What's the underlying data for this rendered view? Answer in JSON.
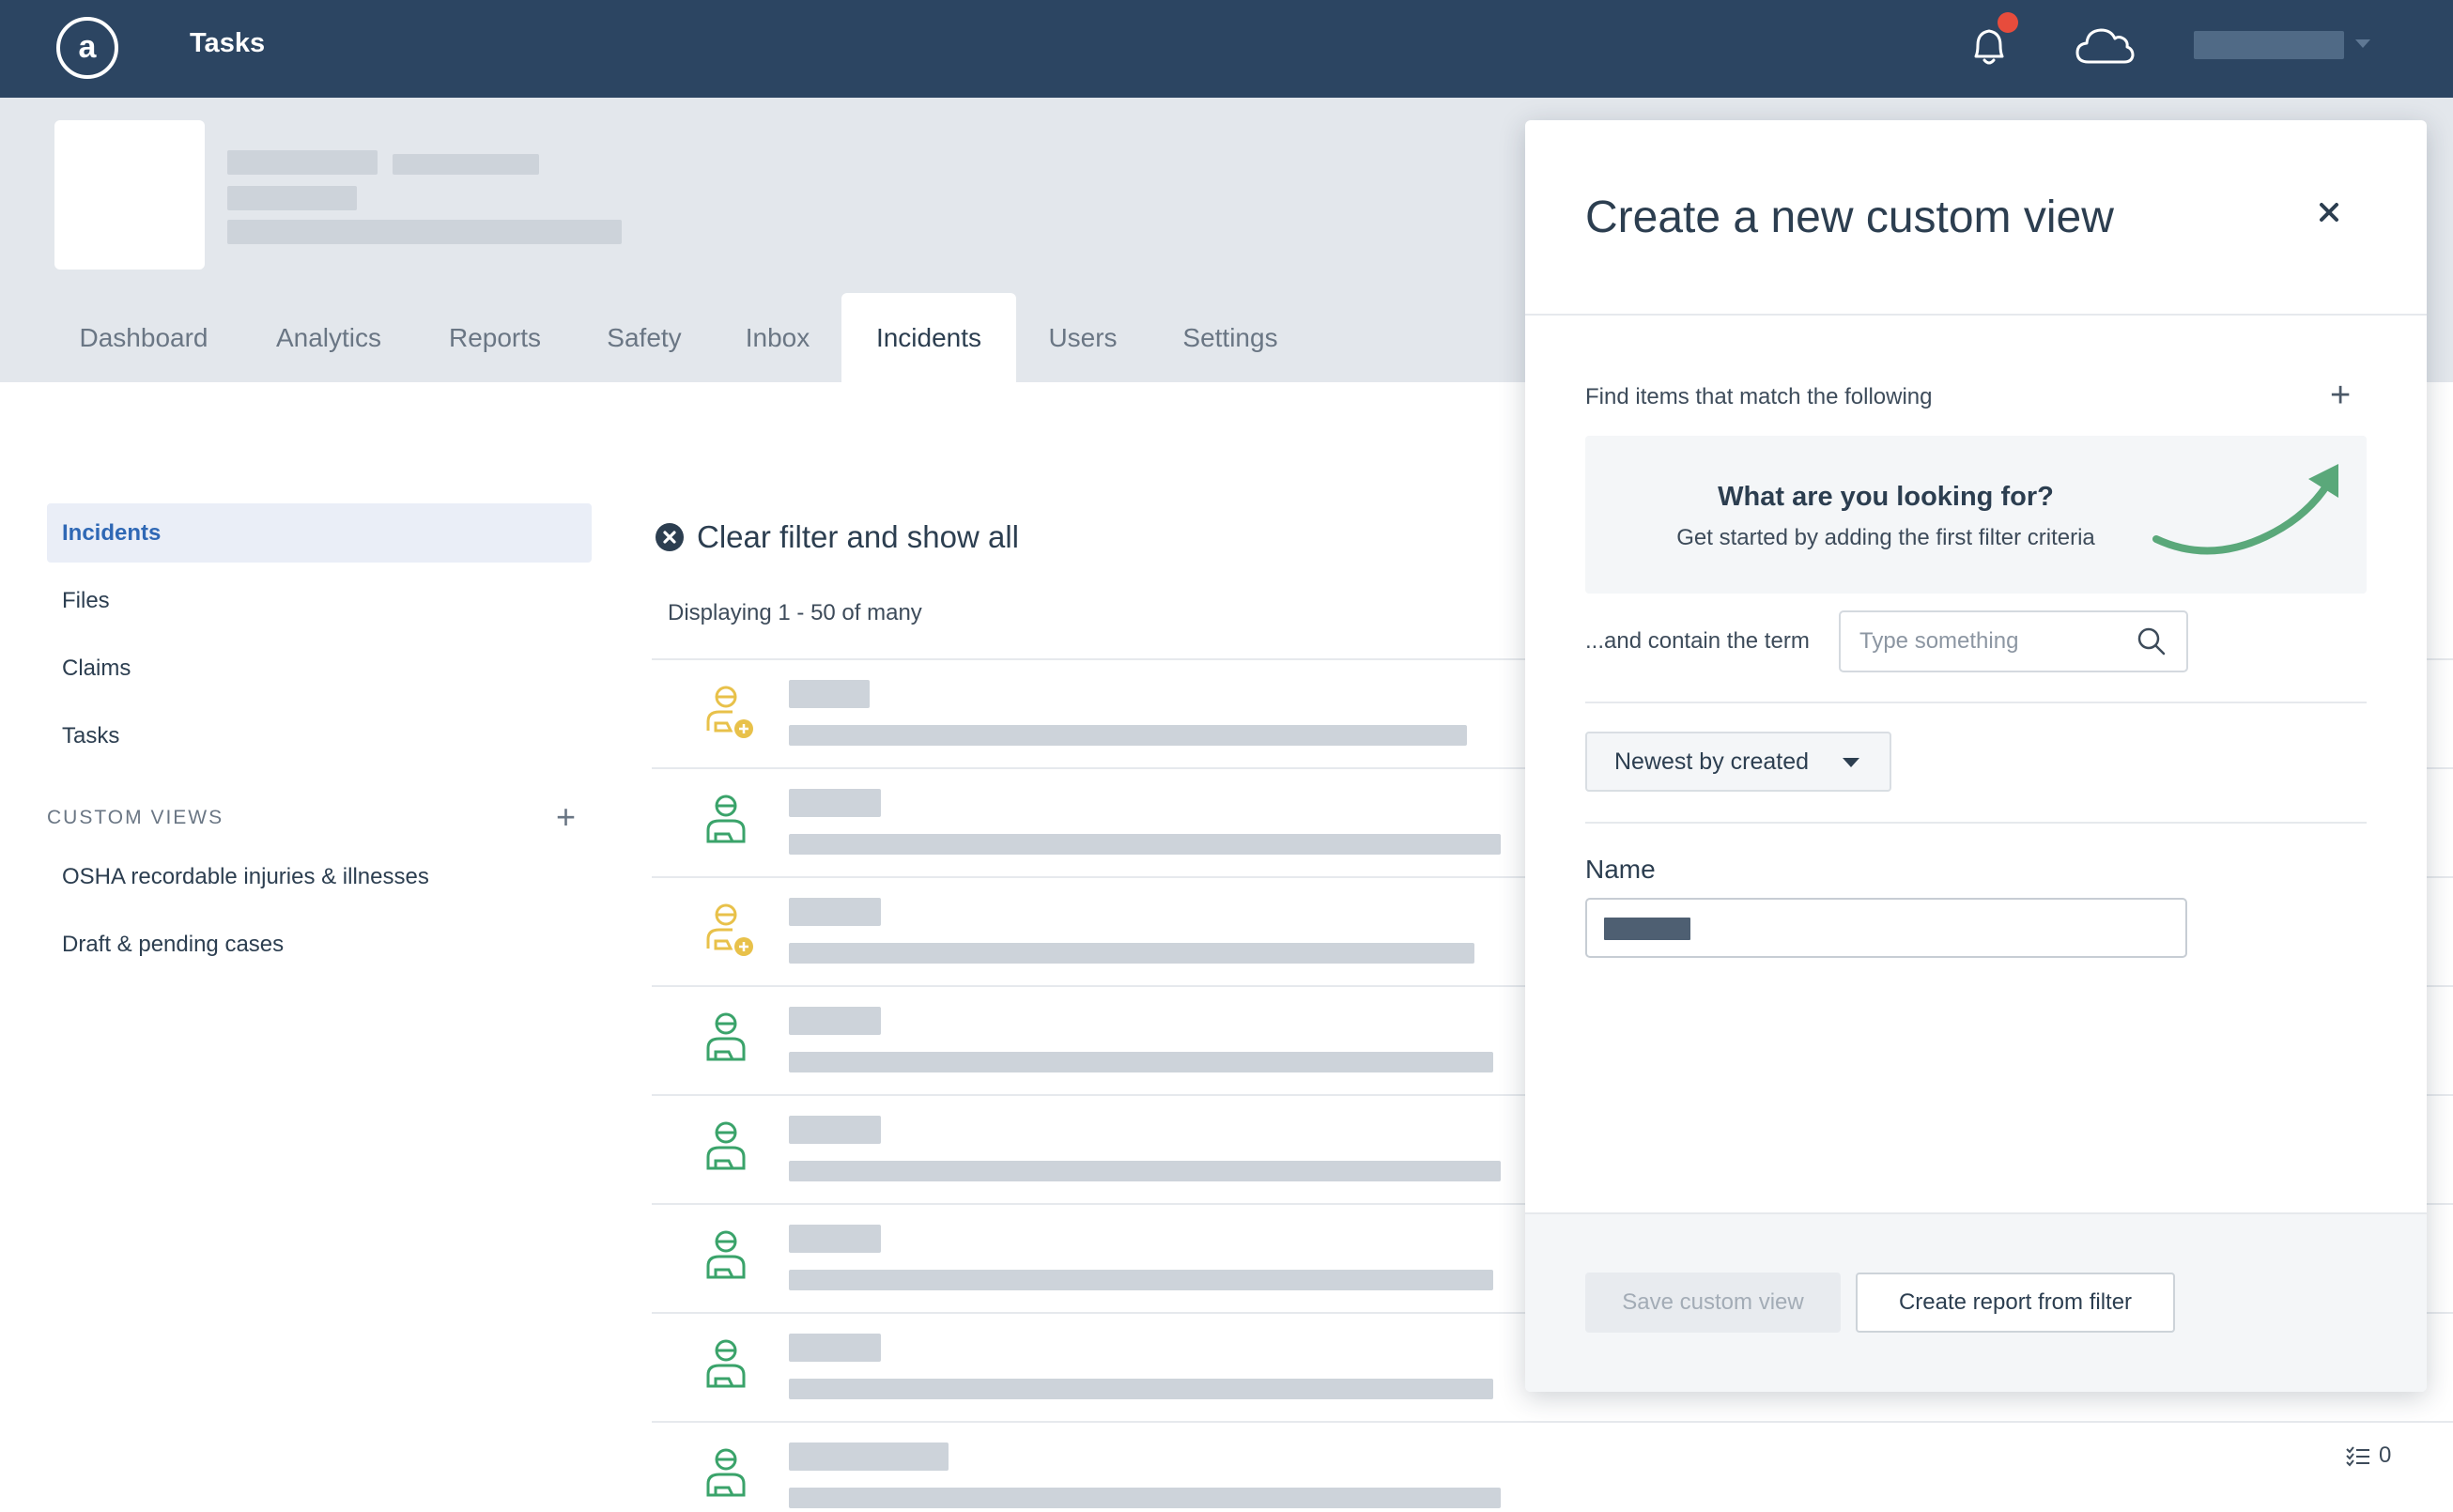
{
  "app": {
    "title": "Tasks"
  },
  "colors": {
    "topbar": "#2c4562",
    "accent": "#2f68b5",
    "notification": "#e74c3c",
    "pending_icon": "#e8c14a",
    "complete_icon": "#3aa36a",
    "hint_arrow": "#5aa87a"
  },
  "tabs": [
    {
      "label": "Dashboard",
      "active": false
    },
    {
      "label": "Analytics",
      "active": false
    },
    {
      "label": "Reports",
      "active": false
    },
    {
      "label": "Safety",
      "active": false
    },
    {
      "label": "Inbox",
      "active": false
    },
    {
      "label": "Incidents",
      "active": true
    },
    {
      "label": "Users",
      "active": false
    },
    {
      "label": "Settings",
      "active": false
    }
  ],
  "sidebar": {
    "items": [
      {
        "label": "Incidents",
        "active": true
      },
      {
        "label": "Files",
        "active": false
      },
      {
        "label": "Claims",
        "active": false
      },
      {
        "label": "Tasks",
        "active": false
      }
    ],
    "custom_views_title": "CUSTOM VIEWS",
    "custom_views": [
      {
        "label": "OSHA recordable injuries & illnesses"
      },
      {
        "label": "Draft & pending cases"
      }
    ]
  },
  "list": {
    "clear_filter": "Clear filter and show all",
    "display_count": "Displaying 1 - 50 of many",
    "rows": [
      {
        "icon": "person-add-icon",
        "status": "pending"
      },
      {
        "icon": "person-icon",
        "status": "complete"
      },
      {
        "icon": "person-add-icon",
        "status": "pending"
      },
      {
        "icon": "person-icon",
        "status": "complete"
      },
      {
        "icon": "person-icon",
        "status": "complete"
      },
      {
        "icon": "person-icon",
        "status": "complete"
      },
      {
        "icon": "person-icon",
        "status": "complete"
      },
      {
        "icon": "person-icon",
        "status": "complete"
      }
    ],
    "task_count": "0"
  },
  "panel": {
    "title": "Create a new custom view",
    "find_label": "Find items that match the following",
    "hint_title": "What are you looking for?",
    "hint_subtitle": "Get started by adding the first filter criteria",
    "contain_label": "...and contain the term",
    "search_placeholder": "Type something",
    "search_value": "",
    "sort_selected": "Newest by created",
    "name_label": "Name",
    "save_button": "Save custom view",
    "report_button": "Create report from filter"
  }
}
